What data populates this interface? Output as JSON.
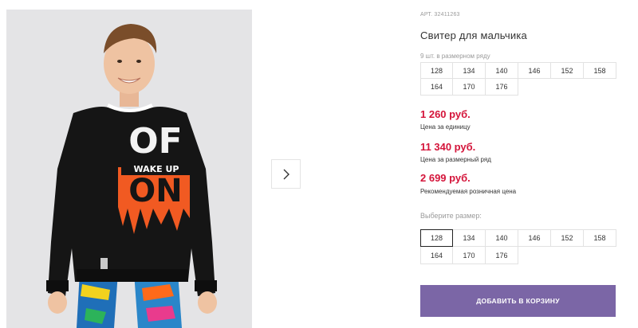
{
  "product": {
    "article": "АРТ. 32411263",
    "title": "Свитер для мальчика",
    "image_alt": "boy-in-black-sweater-photo"
  },
  "pack": {
    "note": "9 шт. в размерном ряду",
    "sizes": [
      "128",
      "134",
      "140",
      "146",
      "152",
      "158",
      "164",
      "170",
      "176"
    ]
  },
  "prices": {
    "unit_price": "1 260 руб.",
    "unit_label": "Цена за единицу",
    "pack_price": "11 340 руб.",
    "pack_label": "Цена за размерный ряд",
    "retail_price": "2 699 руб.",
    "retail_label": "Рекомендуемая розничная цена"
  },
  "size_select": {
    "label": "Выберите размер:",
    "sizes": [
      "128",
      "134",
      "140",
      "146",
      "152",
      "158",
      "164",
      "170",
      "176"
    ],
    "selected": "128"
  },
  "sweater_print": {
    "line1": "OF",
    "line2": "WAKE UP",
    "line3": "ON"
  },
  "cart_button": "ДОБАВИТЬ В КОРЗИНУ",
  "icons": {
    "next": "chevron-right-icon"
  },
  "colors": {
    "accent": "#7b66a6",
    "price": "#d4143a",
    "muted": "#9a9a9a",
    "border": "#e2e2e2"
  }
}
